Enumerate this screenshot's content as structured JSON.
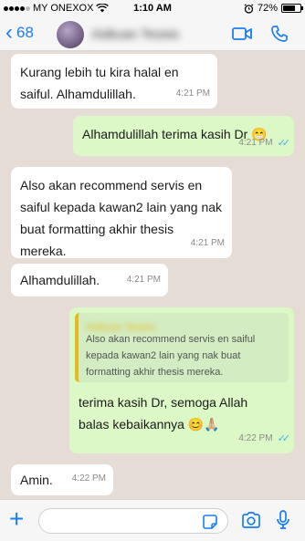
{
  "status": {
    "carrier": "MY ONEXOX",
    "time": "1:10 AM",
    "battery": "72%",
    "battery_level": 0.72
  },
  "header": {
    "back_count": "68",
    "contact_name": "Aidkuan Teswis"
  },
  "messages": [
    {
      "direction": "in",
      "text": "Kurang lebih tu kira halal en saiful. Alhamdulillah.",
      "time": "4:21 PM"
    },
    {
      "direction": "out",
      "text": "Alhamdulillah terima kasih Dr 😁",
      "time": "4:21 PM",
      "status": "read"
    },
    {
      "direction": "in",
      "text": "Also akan recommend servis en saiful kepada kawan2 lain yang nak buat formatting akhir thesis mereka.",
      "time": "4:21 PM"
    },
    {
      "direction": "in",
      "text": "Alhamdulillah.",
      "time": "4:21 PM"
    },
    {
      "direction": "out",
      "quote_name": "Aidkuan Teswis",
      "quote_text": "Also akan recommend servis en saiful kepada kawan2 lain yang nak buat formatting akhir thesis mereka.",
      "text": "terima kasih Dr, semoga Allah balas kebaikannya 😊🙏🏼",
      "time": "4:22 PM",
      "status": "read"
    },
    {
      "direction": "in",
      "text": "Amin.",
      "time": "4:22 PM"
    }
  ],
  "input": {
    "placeholder": ""
  },
  "colors": {
    "accent": "#1a7df2",
    "outgoing_bubble": "#dcf8c6",
    "incoming_bubble": "#ffffff",
    "read_ticks": "#34b7f1",
    "chat_background": "#e5ddd5",
    "quote_bar": "#e4bb1e"
  },
  "icons": {
    "back": "chevron-left-icon",
    "video": "video-camera-icon",
    "call": "phone-icon",
    "attach": "plus-icon",
    "sticker": "sticker-icon",
    "camera": "camera-icon",
    "mic": "microphone-icon"
  }
}
